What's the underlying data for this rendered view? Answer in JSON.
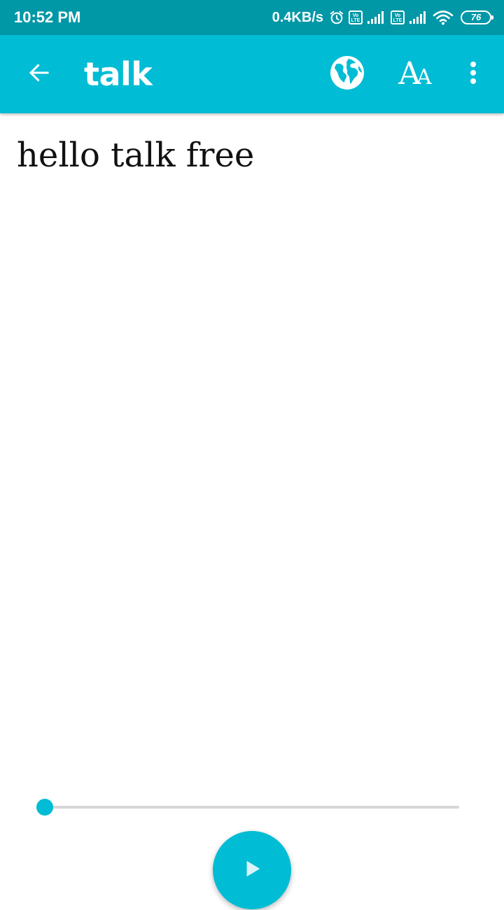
{
  "status_bar": {
    "time": "10:52 PM",
    "net_speed": "0.4KB/s",
    "volte_1": "Vo LTE",
    "volte_2": "Vo LTE",
    "battery": "76",
    "icons": [
      "alarm-icon",
      "volte-icon",
      "signal-icon",
      "volte-icon",
      "signal-icon",
      "wifi-icon",
      "battery-icon"
    ]
  },
  "app_bar": {
    "title": "talk",
    "icons": {
      "back": "arrow-left-icon",
      "language": "globe-icon",
      "font_size": "font-size-icon",
      "more": "more-vert-icon"
    },
    "font_icon_big": "A",
    "font_icon_small": "A"
  },
  "content": {
    "text": "hello talk free"
  },
  "player": {
    "progress": 0,
    "play_icon": "play-icon"
  },
  "colors": {
    "status_bar": "#0097a7",
    "primary": "#00bcd4",
    "track": "#d6d6d6",
    "text": "#111111",
    "background": "#ffffff"
  }
}
